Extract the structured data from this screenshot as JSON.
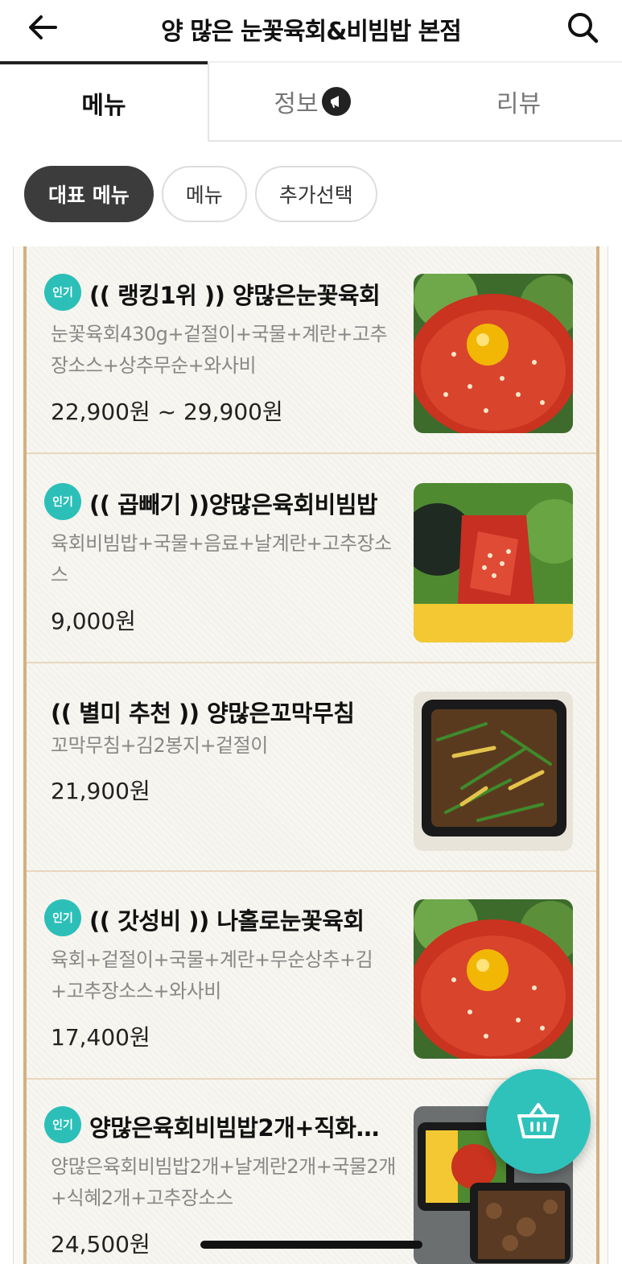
{
  "header": {
    "title": "양 많은 눈꽃육회&비빔밥 본점",
    "back_icon": "arrow-left-icon",
    "search_icon": "search-icon"
  },
  "tabs": [
    {
      "label": "메뉴",
      "active": true
    },
    {
      "label": "정보",
      "icon": "megaphone-icon"
    },
    {
      "label": "리뷰"
    }
  ],
  "chips": [
    {
      "label": "대표 메뉴",
      "selected": true
    },
    {
      "label": "메뉴"
    },
    {
      "label": "추가선택"
    }
  ],
  "menu_items": [
    {
      "badge": "인기",
      "name": "(( 랭킹1위 )) 양많은눈꽃육회",
      "desc": "눈꽃육회430g+겉절이+국물+계란+고추장소스+상추무순+와사비",
      "price": "22,900원 ~ 29,900원",
      "image": "yukhoe-egg-photo"
    },
    {
      "badge": "인기",
      "name": "(( 곱빼기 ))양많은육회비빔밥",
      "desc": "육회비빔밥+국물+음료+날계란+고추장소스",
      "price": "9,000원",
      "image": "bibimbap-photo"
    },
    {
      "badge": "",
      "name": "(( 별미 추천 )) 양많은꼬막무침",
      "desc": "꼬막무침+김2봉지+겉절이",
      "price": "21,900원",
      "image": "cockle-salad-photo"
    },
    {
      "badge": "인기",
      "name": "(( 갓성비 )) 나홀로눈꽃육회",
      "desc": "육회+겉절이+국물+계란+무순상추+김+고추장소스+와사비",
      "price": "17,400원",
      "image": "yukhoe-egg-photo"
    },
    {
      "badge": "인기",
      "name": "양많은육회비빔밥2개+직화…",
      "desc": "양많은육회비빔밥2개+날계란2개+국물2개+식혜2개+고추장소스",
      "price": "24,500원",
      "image": "bibimbap-set-photo"
    }
  ],
  "cart": {
    "icon": "basket-icon"
  },
  "colors": {
    "accent": "#2ec2bb",
    "badge": "#2bbfb8",
    "frame": "#d3b083",
    "chip_selected": "#3c3c3c"
  }
}
